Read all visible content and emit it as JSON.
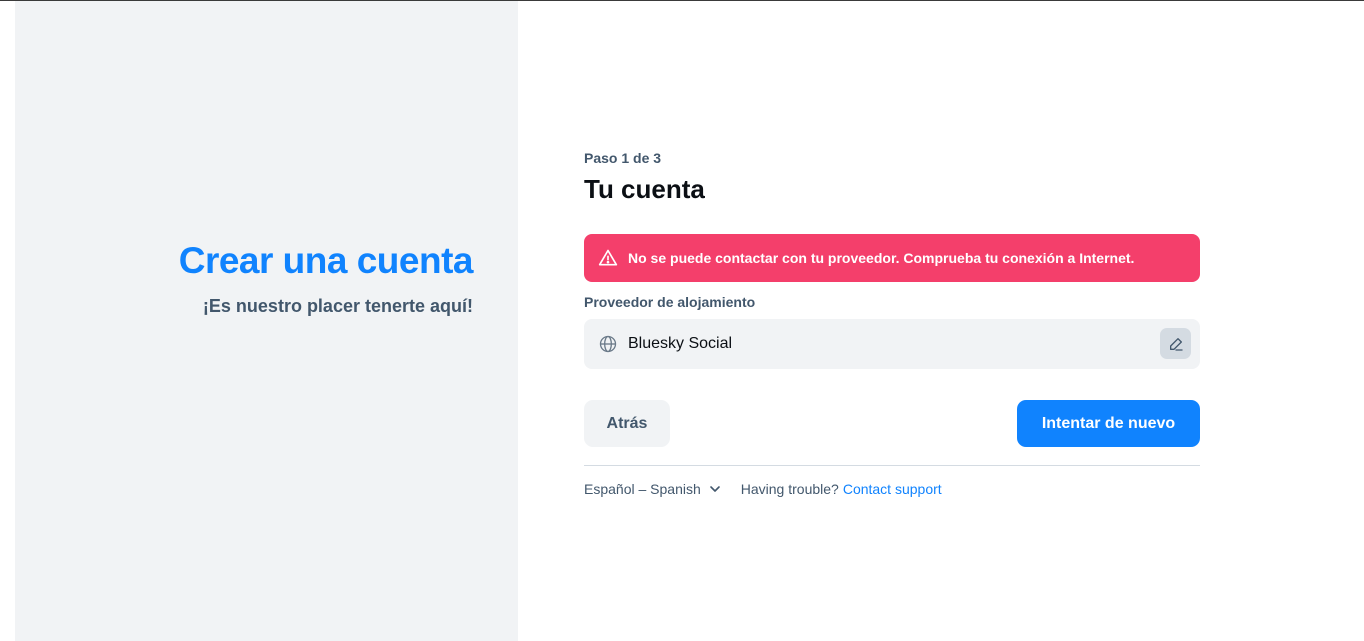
{
  "left": {
    "title": "Crear una cuenta",
    "subtitle": "¡Es nuestro placer tenerte aquí!"
  },
  "form": {
    "step": "Paso 1 de 3",
    "title": "Tu cuenta",
    "error": "No se puede contactar con tu proveedor. Comprueba tu conexión a Internet.",
    "provider_label": "Proveedor de alojamiento",
    "provider_value": "Bluesky Social",
    "back_label": "Atrás",
    "retry_label": "Intentar de nuevo"
  },
  "footer": {
    "language": "Español – Spanish",
    "trouble_text": "Having trouble?",
    "support_link": "Contact support"
  },
  "icons": {
    "error": "warning-triangle-icon",
    "provider": "globe-icon",
    "edit": "pencil-icon",
    "language_dropdown": "chevron-down-icon"
  },
  "colors": {
    "accent": "#1083fe",
    "error_bg": "#f43f6b",
    "panel_bg": "#f1f3f5",
    "muted_text": "#42576c"
  }
}
